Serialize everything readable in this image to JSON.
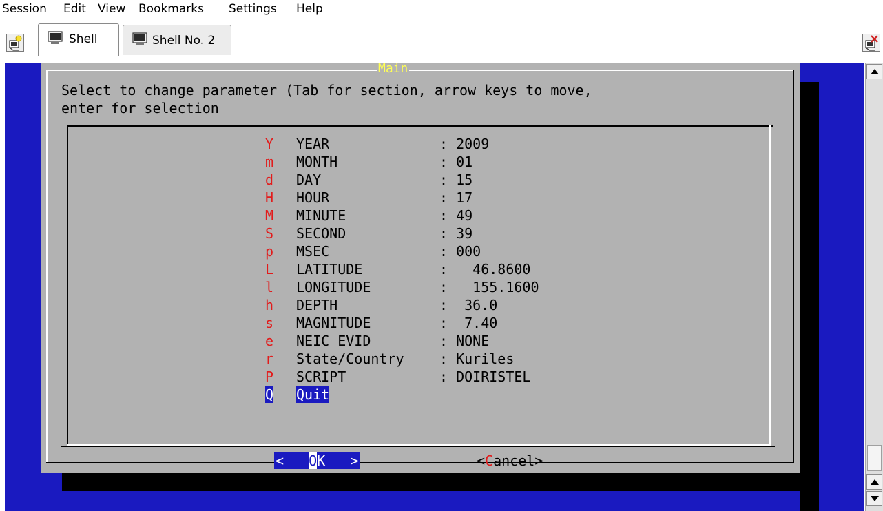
{
  "menu": [
    "Session",
    "Edit",
    "View",
    "Bookmarks",
    "Settings",
    "Help"
  ],
  "tabs": [
    {
      "label": "Shell",
      "active": true
    },
    {
      "label": "Shell No. 2",
      "active": false
    }
  ],
  "dialog": {
    "title": "Main",
    "prompt_line1": "Select to change parameter (Tab for section, arrow keys to move,",
    "prompt_line2": "enter for selection",
    "items": [
      {
        "key": "Y",
        "name": "YEAR",
        "value": ": 2009"
      },
      {
        "key": "m",
        "name": "MONTH",
        "value": ": 01"
      },
      {
        "key": "d",
        "name": "DAY",
        "value": ": 15"
      },
      {
        "key": "H",
        "name": "HOUR",
        "value": ": 17"
      },
      {
        "key": "M",
        "name": "MINUTE",
        "value": ": 49"
      },
      {
        "key": "S",
        "name": "SECOND",
        "value": ": 39"
      },
      {
        "key": "p",
        "name": "MSEC",
        "value": ": 000"
      },
      {
        "key": "L",
        "name": "LATITUDE",
        "value": ":   46.8600"
      },
      {
        "key": "l",
        "name": "LONGITUDE",
        "value": ":   155.1600"
      },
      {
        "key": "h",
        "name": "DEPTH",
        "value": ":  36.0"
      },
      {
        "key": "s",
        "name": "MAGNITUDE",
        "value": ":  7.40"
      },
      {
        "key": "e",
        "name": "NEIC EVID",
        "value": ": NONE"
      },
      {
        "key": "r",
        "name": "State/Country",
        "value": ": Kuriles"
      },
      {
        "key": "P",
        "name": "SCRIPT",
        "value": ": DOIRISTEL"
      },
      {
        "key": "Q",
        "name": "Quit",
        "value": "",
        "selected": true
      }
    ],
    "ok": {
      "open": "<",
      "hot": "O",
      "rest": "K",
      "close": ">"
    },
    "cancel": {
      "open": "<",
      "hot": "C",
      "rest": "ancel",
      "close": ">"
    }
  },
  "colors": {
    "terminal_blue": "#1a1ac0",
    "dialog_gray": "#b2b2b2",
    "title_yellow": "#ffff55",
    "hotkey_red": "#e21b1b"
  },
  "icons": {
    "new_tab": "new-session-icon",
    "close_tab": "close-session-icon",
    "tab": "terminal-monitor-icon"
  }
}
